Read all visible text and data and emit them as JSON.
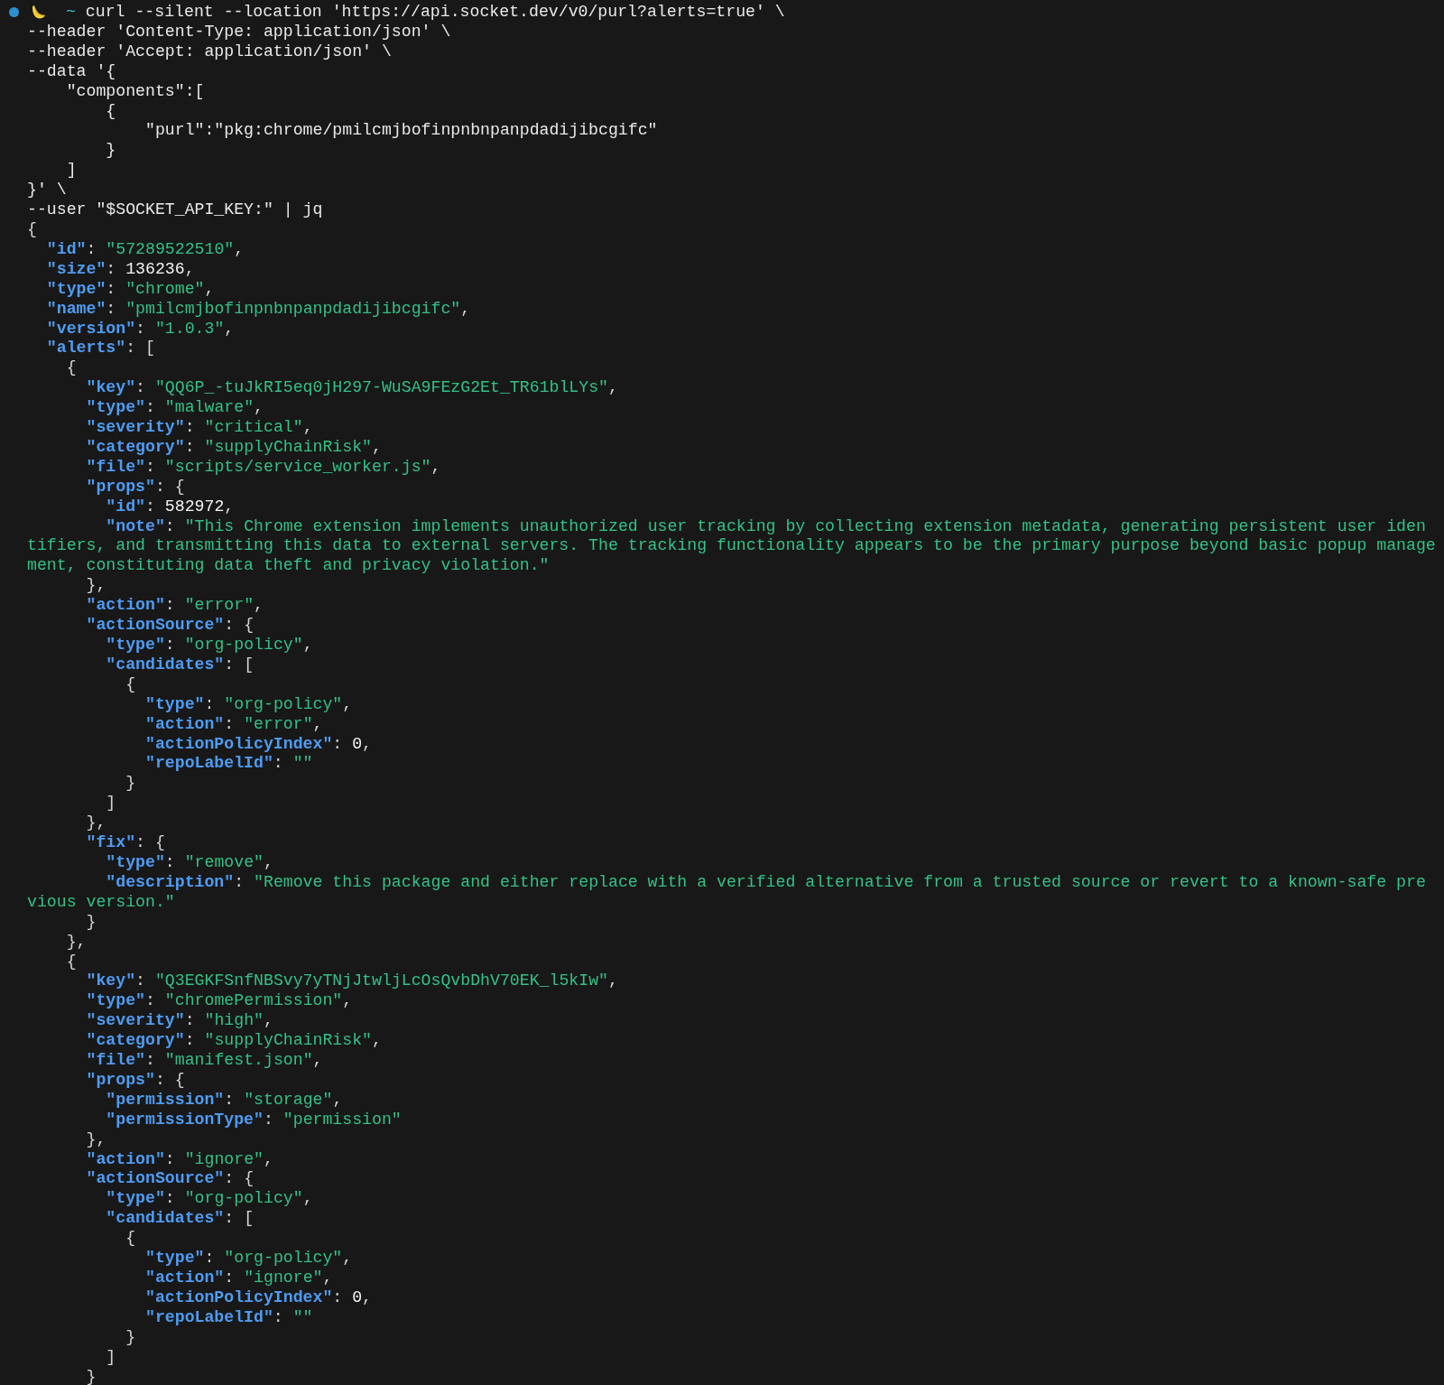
{
  "terminal": {
    "lines": [
      {
        "kind": "prompt",
        "tokens": [
          {
            "kind": "prompt",
            "text": "~"
          },
          {
            "kind": "command",
            "text": "curl --silent --location 'https://api.socket.dev/v0/purl?alerts=true' \\"
          }
        ]
      },
      {
        "kind": "command",
        "tokens": [
          {
            "kind": "command",
            "text": "--header 'Content-Type: application/json' \\"
          }
        ]
      },
      {
        "kind": "command",
        "tokens": [
          {
            "kind": "command",
            "text": "--header 'Accept: application/json' \\"
          }
        ]
      },
      {
        "kind": "command",
        "tokens": [
          {
            "kind": "command",
            "text": "--data '{"
          }
        ],
        "children": [
          {
            "kind": "command",
            "tokens": [
              {
                "kind": "command",
                "text": "\"components\":["
              }
            ],
            "children": [
              {
                "kind": "command",
                "tokens": [
                  {
                    "kind": "command",
                    "text": "{"
                  }
                ],
                "children": [
                  {
                    "kind": "command",
                    "tokens": [
                      {
                        "kind": "command",
                        "text": "\"purl\":\"pkg:chrome/pmilcmjbofinpnbnpanpdadijibcgifc\""
                      }
                    ]
                  }
                ]
              },
              {
                "kind": "command",
                "tokens": [
                  {
                    "kind": "command",
                    "text": "}"
                  }
                ]
              }
            ]
          },
          {
            "kind": "command",
            "tokens": [
              {
                "kind": "command",
                "text": "]"
              }
            ]
          }
        ]
      },
      {
        "kind": "command",
        "tokens": [
          {
            "kind": "command",
            "text": "}' \\"
          }
        ]
      },
      {
        "kind": "command",
        "tokens": [
          {
            "kind": "command",
            "text": "--user \"$SOCKET_API_KEY:\" | jq"
          }
        ]
      },
      {
        "kind": "json",
        "tokens": [
          {
            "kind": "punct",
            "text": "{"
          }
        ],
        "children": [
          {
            "kind": "json",
            "tokens": [
              {
                "kind": "key",
                "text": "\"id\""
              },
              {
                "kind": "punct",
                "text": ": "
              },
              {
                "kind": "string",
                "text": "\"57289522510\""
              },
              {
                "kind": "punct",
                "text": ","
              }
            ]
          },
          {
            "kind": "json",
            "tokens": [
              {
                "kind": "key",
                "text": "\"size\""
              },
              {
                "kind": "punct",
                "text": ": "
              },
              {
                "kind": "number",
                "text": "136236"
              },
              {
                "kind": "punct",
                "text": ","
              }
            ]
          },
          {
            "kind": "json",
            "tokens": [
              {
                "kind": "key",
                "text": "\"type\""
              },
              {
                "kind": "punct",
                "text": ": "
              },
              {
                "kind": "string",
                "text": "\"chrome\""
              },
              {
                "kind": "punct",
                "text": ","
              }
            ]
          },
          {
            "kind": "json",
            "tokens": [
              {
                "kind": "key",
                "text": "\"name\""
              },
              {
                "kind": "punct",
                "text": ": "
              },
              {
                "kind": "string",
                "text": "\"pmilcmjbofinpnbnpanpdadijibcgifc\""
              },
              {
                "kind": "punct",
                "text": ","
              }
            ]
          },
          {
            "kind": "json",
            "tokens": [
              {
                "kind": "key",
                "text": "\"version\""
              },
              {
                "kind": "punct",
                "text": ": "
              },
              {
                "kind": "string",
                "text": "\"1.0.3\""
              },
              {
                "kind": "punct",
                "text": ","
              }
            ]
          },
          {
            "kind": "json",
            "tokens": [
              {
                "kind": "key",
                "text": "\"alerts\""
              },
              {
                "kind": "punct",
                "text": ": ["
              }
            ],
            "children": [
              {
                "kind": "json",
                "tokens": [
                  {
                    "kind": "punct",
                    "text": "{"
                  }
                ],
                "children": [
                  {
                    "kind": "json",
                    "tokens": [
                      {
                        "kind": "key",
                        "text": "\"key\""
                      },
                      {
                        "kind": "punct",
                        "text": ": "
                      },
                      {
                        "kind": "string",
                        "text": "\"QQ6P_-tuJkRI5eq0jH297-WuSA9FEzG2Et_TR61blLYs\""
                      },
                      {
                        "kind": "punct",
                        "text": ","
                      }
                    ]
                  },
                  {
                    "kind": "json",
                    "tokens": [
                      {
                        "kind": "key",
                        "text": "\"type\""
                      },
                      {
                        "kind": "punct",
                        "text": ": "
                      },
                      {
                        "kind": "string",
                        "text": "\"malware\""
                      },
                      {
                        "kind": "punct",
                        "text": ","
                      }
                    ]
                  },
                  {
                    "kind": "json",
                    "tokens": [
                      {
                        "kind": "key",
                        "text": "\"severity\""
                      },
                      {
                        "kind": "punct",
                        "text": ": "
                      },
                      {
                        "kind": "string",
                        "text": "\"critical\""
                      },
                      {
                        "kind": "punct",
                        "text": ","
                      }
                    ]
                  },
                  {
                    "kind": "json",
                    "tokens": [
                      {
                        "kind": "key",
                        "text": "\"category\""
                      },
                      {
                        "kind": "punct",
                        "text": ": "
                      },
                      {
                        "kind": "string",
                        "text": "\"supplyChainRisk\""
                      },
                      {
                        "kind": "punct",
                        "text": ","
                      }
                    ]
                  },
                  {
                    "kind": "json",
                    "tokens": [
                      {
                        "kind": "key",
                        "text": "\"file\""
                      },
                      {
                        "kind": "punct",
                        "text": ": "
                      },
                      {
                        "kind": "string",
                        "text": "\"scripts/service_worker.js\""
                      },
                      {
                        "kind": "punct",
                        "text": ","
                      }
                    ]
                  },
                  {
                    "kind": "json",
                    "tokens": [
                      {
                        "kind": "key",
                        "text": "\"props\""
                      },
                      {
                        "kind": "punct",
                        "text": ": {"
                      }
                    ],
                    "children": [
                      {
                        "kind": "json",
                        "tokens": [
                          {
                            "kind": "key",
                            "text": "\"id\""
                          },
                          {
                            "kind": "punct",
                            "text": ": "
                          },
                          {
                            "kind": "number",
                            "text": "582972"
                          },
                          {
                            "kind": "punct",
                            "text": ","
                          }
                        ]
                      },
                      {
                        "kind": "wrap",
                        "tokens": [
                          {
                            "kind": "key",
                            "text": "\"note\""
                          },
                          {
                            "kind": "punct",
                            "text": ": "
                          },
                          {
                            "kind": "string",
                            "text": "\"This Chrome extension implements unauthorized user tracking by collecting extension metadata, generating persistent user identifiers, and transmitting this data to external servers. The tracking functionality appears to be the primary purpose beyond basic popup management, constituting data theft and privacy violation.\""
                          }
                        ]
                      }
                    ]
                  },
                  {
                    "kind": "json",
                    "tokens": [
                      {
                        "kind": "punct",
                        "text": "},"
                      }
                    ]
                  },
                  {
                    "kind": "json",
                    "tokens": [
                      {
                        "kind": "key",
                        "text": "\"action\""
                      },
                      {
                        "kind": "punct",
                        "text": ": "
                      },
                      {
                        "kind": "string",
                        "text": "\"error\""
                      },
                      {
                        "kind": "punct",
                        "text": ","
                      }
                    ]
                  },
                  {
                    "kind": "json",
                    "tokens": [
                      {
                        "kind": "key",
                        "text": "\"actionSource\""
                      },
                      {
                        "kind": "punct",
                        "text": ": {"
                      }
                    ],
                    "children": [
                      {
                        "kind": "json",
                        "tokens": [
                          {
                            "kind": "key",
                            "text": "\"type\""
                          },
                          {
                            "kind": "punct",
                            "text": ": "
                          },
                          {
                            "kind": "string",
                            "text": "\"org-policy\""
                          },
                          {
                            "kind": "punct",
                            "text": ","
                          }
                        ]
                      },
                      {
                        "kind": "json",
                        "tokens": [
                          {
                            "kind": "key",
                            "text": "\"candidates\""
                          },
                          {
                            "kind": "punct",
                            "text": ": ["
                          }
                        ],
                        "children": [
                          {
                            "kind": "json",
                            "tokens": [
                              {
                                "kind": "punct",
                                "text": "{"
                              }
                            ],
                            "children": [
                              {
                                "kind": "json",
                                "tokens": [
                                  {
                                    "kind": "key",
                                    "text": "\"type\""
                                  },
                                  {
                                    "kind": "punct",
                                    "text": ": "
                                  },
                                  {
                                    "kind": "string",
                                    "text": "\"org-policy\""
                                  },
                                  {
                                    "kind": "punct",
                                    "text": ","
                                  }
                                ]
                              },
                              {
                                "kind": "json",
                                "tokens": [
                                  {
                                    "kind": "key",
                                    "text": "\"action\""
                                  },
                                  {
                                    "kind": "punct",
                                    "text": ": "
                                  },
                                  {
                                    "kind": "string",
                                    "text": "\"error\""
                                  },
                                  {
                                    "kind": "punct",
                                    "text": ","
                                  }
                                ]
                              },
                              {
                                "kind": "json",
                                "tokens": [
                                  {
                                    "kind": "key",
                                    "text": "\"actionPolicyIndex\""
                                  },
                                  {
                                    "kind": "punct",
                                    "text": ": "
                                  },
                                  {
                                    "kind": "number",
                                    "text": "0"
                                  },
                                  {
                                    "kind": "punct",
                                    "text": ","
                                  }
                                ]
                              },
                              {
                                "kind": "json",
                                "tokens": [
                                  {
                                    "kind": "key",
                                    "text": "\"repoLabelId\""
                                  },
                                  {
                                    "kind": "punct",
                                    "text": ": "
                                  },
                                  {
                                    "kind": "string",
                                    "text": "\"\""
                                  }
                                ]
                              }
                            ]
                          },
                          {
                            "kind": "json",
                            "tokens": [
                              {
                                "kind": "punct",
                                "text": "}"
                              }
                            ]
                          }
                        ]
                      },
                      {
                        "kind": "json",
                        "tokens": [
                          {
                            "kind": "punct",
                            "text": "]"
                          }
                        ]
                      }
                    ]
                  },
                  {
                    "kind": "json",
                    "tokens": [
                      {
                        "kind": "punct",
                        "text": "},"
                      }
                    ]
                  },
                  {
                    "kind": "json",
                    "tokens": [
                      {
                        "kind": "key",
                        "text": "\"fix\""
                      },
                      {
                        "kind": "punct",
                        "text": ": {"
                      }
                    ],
                    "children": [
                      {
                        "kind": "json",
                        "tokens": [
                          {
                            "kind": "key",
                            "text": "\"type\""
                          },
                          {
                            "kind": "punct",
                            "text": ": "
                          },
                          {
                            "kind": "string",
                            "text": "\"remove\""
                          },
                          {
                            "kind": "punct",
                            "text": ","
                          }
                        ]
                      },
                      {
                        "kind": "wrap",
                        "tokens": [
                          {
                            "kind": "key",
                            "text": "\"description\""
                          },
                          {
                            "kind": "punct",
                            "text": ": "
                          },
                          {
                            "kind": "string",
                            "text": "\"Remove this package and either replace with a verified alternative from a trusted source or revert to a known-safe previous version.\""
                          }
                        ]
                      }
                    ]
                  },
                  {
                    "kind": "json",
                    "tokens": [
                      {
                        "kind": "punct",
                        "text": "}"
                      }
                    ]
                  }
                ]
              },
              {
                "kind": "json",
                "tokens": [
                  {
                    "kind": "punct",
                    "text": "},"
                  }
                ]
              },
              {
                "kind": "json",
                "tokens": [
                  {
                    "kind": "punct",
                    "text": "{"
                  }
                ],
                "children": [
                  {
                    "kind": "json",
                    "tokens": [
                      {
                        "kind": "key",
                        "text": "\"key\""
                      },
                      {
                        "kind": "punct",
                        "text": ": "
                      },
                      {
                        "kind": "string",
                        "text": "\"Q3EGKFSnfNBSvy7yTNjJtwljLcOsQvbDhV70EK_l5kIw\""
                      },
                      {
                        "kind": "punct",
                        "text": ","
                      }
                    ]
                  },
                  {
                    "kind": "json",
                    "tokens": [
                      {
                        "kind": "key",
                        "text": "\"type\""
                      },
                      {
                        "kind": "punct",
                        "text": ": "
                      },
                      {
                        "kind": "string",
                        "text": "\"chromePermission\""
                      },
                      {
                        "kind": "punct",
                        "text": ","
                      }
                    ]
                  },
                  {
                    "kind": "json",
                    "tokens": [
                      {
                        "kind": "key",
                        "text": "\"severity\""
                      },
                      {
                        "kind": "punct",
                        "text": ": "
                      },
                      {
                        "kind": "string",
                        "text": "\"high\""
                      },
                      {
                        "kind": "punct",
                        "text": ","
                      }
                    ]
                  },
                  {
                    "kind": "json",
                    "tokens": [
                      {
                        "kind": "key",
                        "text": "\"category\""
                      },
                      {
                        "kind": "punct",
                        "text": ": "
                      },
                      {
                        "kind": "string",
                        "text": "\"supplyChainRisk\""
                      },
                      {
                        "kind": "punct",
                        "text": ","
                      }
                    ]
                  },
                  {
                    "kind": "json",
                    "tokens": [
                      {
                        "kind": "key",
                        "text": "\"file\""
                      },
                      {
                        "kind": "punct",
                        "text": ": "
                      },
                      {
                        "kind": "string",
                        "text": "\"manifest.json\""
                      },
                      {
                        "kind": "punct",
                        "text": ","
                      }
                    ]
                  },
                  {
                    "kind": "json",
                    "tokens": [
                      {
                        "kind": "key",
                        "text": "\"props\""
                      },
                      {
                        "kind": "punct",
                        "text": ": {"
                      }
                    ],
                    "children": [
                      {
                        "kind": "json",
                        "tokens": [
                          {
                            "kind": "key",
                            "text": "\"permission\""
                          },
                          {
                            "kind": "punct",
                            "text": ": "
                          },
                          {
                            "kind": "string",
                            "text": "\"storage\""
                          },
                          {
                            "kind": "punct",
                            "text": ","
                          }
                        ]
                      },
                      {
                        "kind": "json",
                        "tokens": [
                          {
                            "kind": "key",
                            "text": "\"permissionType\""
                          },
                          {
                            "kind": "punct",
                            "text": ": "
                          },
                          {
                            "kind": "string",
                            "text": "\"permission\""
                          }
                        ]
                      }
                    ]
                  },
                  {
                    "kind": "json",
                    "tokens": [
                      {
                        "kind": "punct",
                        "text": "},"
                      }
                    ]
                  },
                  {
                    "kind": "json",
                    "tokens": [
                      {
                        "kind": "key",
                        "text": "\"action\""
                      },
                      {
                        "kind": "punct",
                        "text": ": "
                      },
                      {
                        "kind": "string",
                        "text": "\"ignore\""
                      },
                      {
                        "kind": "punct",
                        "text": ","
                      }
                    ]
                  },
                  {
                    "kind": "json",
                    "tokens": [
                      {
                        "kind": "key",
                        "text": "\"actionSource\""
                      },
                      {
                        "kind": "punct",
                        "text": ": {"
                      }
                    ],
                    "children": [
                      {
                        "kind": "json",
                        "tokens": [
                          {
                            "kind": "key",
                            "text": "\"type\""
                          },
                          {
                            "kind": "punct",
                            "text": ": "
                          },
                          {
                            "kind": "string",
                            "text": "\"org-policy\""
                          },
                          {
                            "kind": "punct",
                            "text": ","
                          }
                        ]
                      },
                      {
                        "kind": "json",
                        "tokens": [
                          {
                            "kind": "key",
                            "text": "\"candidates\""
                          },
                          {
                            "kind": "punct",
                            "text": ": ["
                          }
                        ],
                        "children": [
                          {
                            "kind": "json",
                            "tokens": [
                              {
                                "kind": "punct",
                                "text": "{"
                              }
                            ],
                            "children": [
                              {
                                "kind": "json",
                                "tokens": [
                                  {
                                    "kind": "key",
                                    "text": "\"type\""
                                  },
                                  {
                                    "kind": "punct",
                                    "text": ": "
                                  },
                                  {
                                    "kind": "string",
                                    "text": "\"org-policy\""
                                  },
                                  {
                                    "kind": "punct",
                                    "text": ","
                                  }
                                ]
                              },
                              {
                                "kind": "json",
                                "tokens": [
                                  {
                                    "kind": "key",
                                    "text": "\"action\""
                                  },
                                  {
                                    "kind": "punct",
                                    "text": ": "
                                  },
                                  {
                                    "kind": "string",
                                    "text": "\"ignore\""
                                  },
                                  {
                                    "kind": "punct",
                                    "text": ","
                                  }
                                ]
                              },
                              {
                                "kind": "json",
                                "tokens": [
                                  {
                                    "kind": "key",
                                    "text": "\"actionPolicyIndex\""
                                  },
                                  {
                                    "kind": "punct",
                                    "text": ": "
                                  },
                                  {
                                    "kind": "number",
                                    "text": "0"
                                  },
                                  {
                                    "kind": "punct",
                                    "text": ","
                                  }
                                ]
                              },
                              {
                                "kind": "json",
                                "tokens": [
                                  {
                                    "kind": "key",
                                    "text": "\"repoLabelId\""
                                  },
                                  {
                                    "kind": "punct",
                                    "text": ": "
                                  },
                                  {
                                    "kind": "string",
                                    "text": "\"\""
                                  }
                                ]
                              }
                            ]
                          },
                          {
                            "kind": "json",
                            "tokens": [
                              {
                                "kind": "punct",
                                "text": "}"
                              }
                            ]
                          }
                        ]
                      },
                      {
                        "kind": "json",
                        "tokens": [
                          {
                            "kind": "punct",
                            "text": "]"
                          }
                        ]
                      }
                    ]
                  },
                  {
                    "kind": "json",
                    "tokens": [
                      {
                        "kind": "punct",
                        "text": "}"
                      }
                    ]
                  }
                ]
              }
            ]
          }
        ]
      }
    ]
  }
}
